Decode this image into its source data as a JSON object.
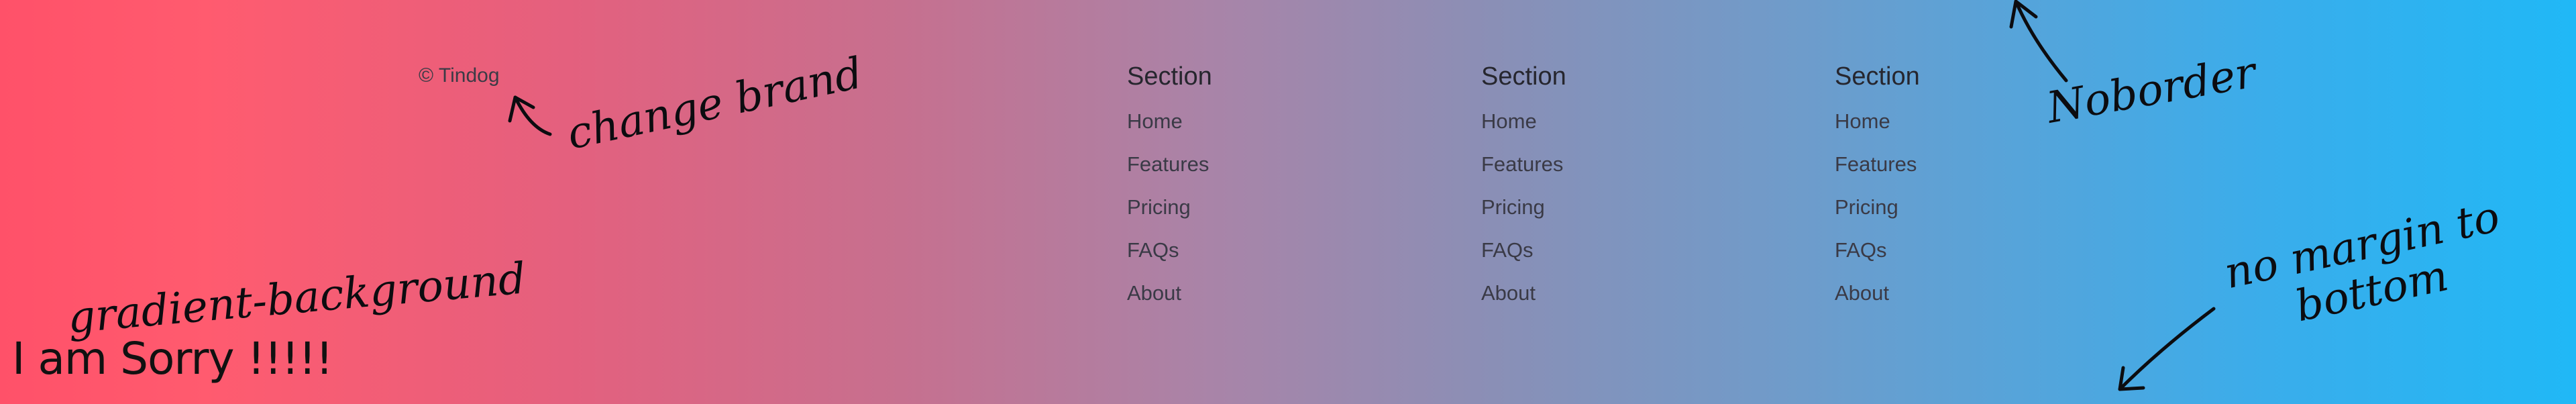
{
  "brand": {
    "text": "© Tindog"
  },
  "sections": [
    {
      "title": "Section",
      "links": [
        "Home",
        "Features",
        "Pricing",
        "FAQs",
        "About"
      ]
    },
    {
      "title": "Section",
      "links": [
        "Home",
        "Features",
        "Pricing",
        "FAQs",
        "About"
      ]
    },
    {
      "title": "Section",
      "links": [
        "Home",
        "Features",
        "Pricing",
        "FAQs",
        "About"
      ]
    }
  ],
  "overlay_text": "I am Sorry !!!!!",
  "annotations": {
    "brand_note": "change brand",
    "gradient_note": "gradient-background",
    "border_note": "Noborder",
    "margin_note_line1": "no margin to",
    "margin_note_line2": "bottom"
  },
  "colors": {
    "gradient_start": "#ff5169",
    "gradient_end": "#20b8f6",
    "link": "#3a3a46",
    "heading": "#26262e"
  }
}
